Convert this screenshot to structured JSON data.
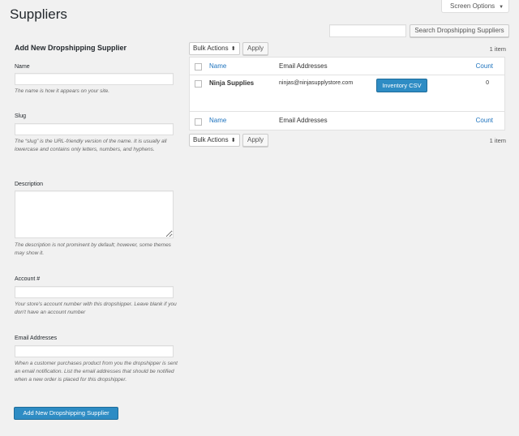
{
  "page": {
    "title": "Suppliers",
    "screen_options_label": "Screen Options",
    "screen_options_arrow": "▼"
  },
  "search": {
    "value": "",
    "button_label": "Search Dropshipping Suppliers"
  },
  "form": {
    "title": "Add New Dropshipping Supplier",
    "name": {
      "label": "Name",
      "value": "",
      "help": "The name is how it appears on your site."
    },
    "slug": {
      "label": "Slug",
      "value": "",
      "help": "The “slug” is the URL-friendly version of the name. It is usually all lowercase and contains only letters, numbers, and hyphens."
    },
    "description": {
      "label": "Description",
      "value": "",
      "help": "The description is not prominent by default; however, some themes may show it."
    },
    "account": {
      "label": "Account #",
      "value": "",
      "help": "Your store's account number with this dropshipper. Leave blank if you don't have an account number"
    },
    "emails": {
      "label": "Email Addresses",
      "value": "",
      "help": "When a customer purchases product from you the dropshipper is sent an email notification. List the email addresses that should be notified when a new order is placed for this dropshipper."
    },
    "submit_label": "Add New Dropshipping Supplier"
  },
  "bulk": {
    "top": {
      "selected": "Bulk Actions",
      "arrow": "⬍",
      "apply_label": "Apply"
    },
    "bottom": {
      "selected": "Bulk Actions",
      "arrow": "⬍",
      "apply_label": "Apply"
    }
  },
  "pagination": {
    "top_count": "1 item",
    "bottom_count": "1 item"
  },
  "table": {
    "columns": {
      "name": "Name",
      "emails": "Email Addresses",
      "count": "Count"
    },
    "rows": [
      {
        "name": "Ninja Supplies",
        "email": "ninjas@ninjasupplystore.com",
        "action_label": "Inventory CSV",
        "count": "0"
      }
    ]
  },
  "colors": {
    "primary": "#2e8cc4",
    "link": "#1e73be",
    "background": "#f1f1f1"
  }
}
